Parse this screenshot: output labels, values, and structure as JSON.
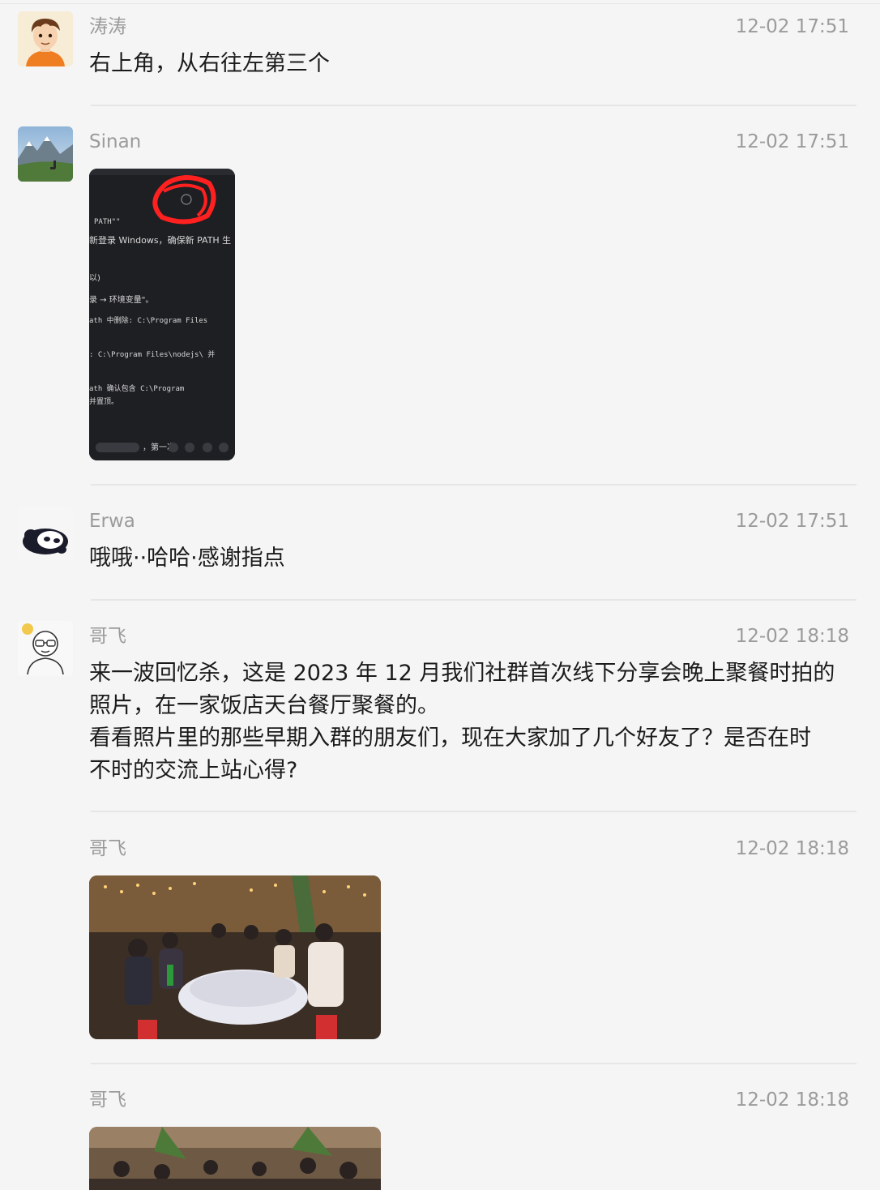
{
  "messages": [
    {
      "sender": "涛涛",
      "time": "12-02 17:51",
      "text": "右上角，从右往左第三个",
      "avatar": "cartoon-boy-avatar"
    },
    {
      "sender": "Sinan",
      "time": "12-02 17:51",
      "image": "screenshot-image",
      "avatar": "mountain-landscape-avatar",
      "screenshot_lines": [
        "PATH\"\"",
        "新登录 Windows，确保新 PATH 生",
        "以)",
        "录 → 环境变量\"。",
        "ath 中删除: C:\\Program Files",
        ": C:\\Program Files\\nodejs\\ 并",
        "ath 确认包含 C:\\Program",
        "并置顶。",
        "，第一次"
      ]
    },
    {
      "sender": "Erwa",
      "time": "12-02 17:51",
      "text": "哦哦··哈哈·感谢指点",
      "avatar": "panda-avatar"
    },
    {
      "sender": "哥飞",
      "time": "12-02 18:18",
      "avatar": "glasses-man-avatar",
      "text_lines": [
        "来一波回忆杀，这是 2023 年 12 月我们社群首次线下分享会晚上聚餐时拍的",
        "照片，在一家饭店天台餐厅聚餐的。",
        "看看照片里的那些早期入群的朋友们，现在大家加了几个好友了？是否在时",
        "不时的交流上站心得?"
      ]
    },
    {
      "sender": "哥飞",
      "time": "12-02 18:18",
      "image": "group-dinner-photo"
    },
    {
      "sender": "哥飞",
      "time": "12-02 18:18",
      "image": "group-dinner-photo-2"
    }
  ]
}
